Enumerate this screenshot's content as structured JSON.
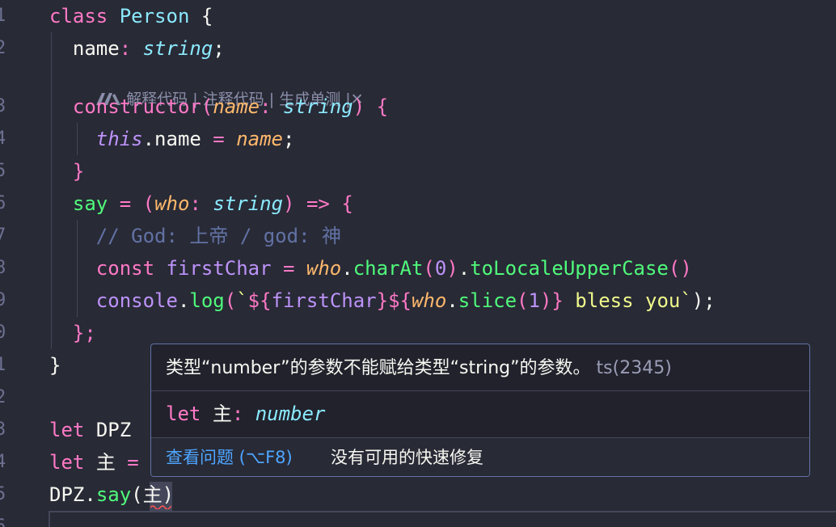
{
  "colors": {
    "background": "#282a36",
    "keyword": "#ff79c6",
    "class": "#8be9fd",
    "param": "#ffb86c",
    "function": "#50fa7b",
    "string": "#f1fa8c",
    "comment": "#6272a4",
    "link": "#4fa6ff",
    "error": "#ff5555"
  },
  "gutter": {
    "line_numbers": [
      "1",
      "2",
      "3",
      "4",
      "5",
      "6",
      "7",
      "8",
      "9",
      "0",
      "1",
      "2",
      "3",
      "4",
      "5",
      "6"
    ]
  },
  "code_lens": {
    "icon": "marscode-logo-icon",
    "explain": "解释代码",
    "annotate": "注释代码",
    "unit_test": "生成单测",
    "sep": "|",
    "close": "✕"
  },
  "code": {
    "l1": {
      "kw": "class",
      "name": "Person",
      "brace": "{"
    },
    "l2": {
      "prop": "name",
      "colon": ":",
      "type": "string",
      "semi": ";"
    },
    "l3": {
      "fn": "constructor",
      "lp": "(",
      "param": "name",
      "colon": ":",
      "type": "string",
      "rp": ")",
      "brace": "{"
    },
    "l4": {
      "this": "this",
      "prop": ".name",
      "eq": "=",
      "param": "name",
      "semi": ";"
    },
    "l5": {
      "brace": "}"
    },
    "l6": {
      "fn": "say",
      "eq": "=",
      "lp": "(",
      "param": "who",
      "colon": ":",
      "type": "string",
      "rp": ")",
      "arrow": "=>",
      "brace": "{"
    },
    "l7": {
      "comment": "// God: 上帝 / god: 神"
    },
    "l8": {
      "kw": "const",
      "var": "firstChar",
      "eq": "=",
      "param": "who",
      "dot1": ".",
      "m1": "charAt",
      "lp": "(",
      "num": "0",
      "rp": ")",
      "dot2": ".",
      "m2": "toLocaleUpperCase",
      "call": "()"
    },
    "l9": {
      "obj": "console",
      "dot": ".",
      "m": "log",
      "lp": "(",
      "tick": "`",
      "i1o": "${",
      "v1": "firstChar",
      "i1c": "}",
      "i2o": "${",
      "v2": "who",
      "dot2": ".",
      "m2": "slice",
      "lp2": "(",
      "num": "1",
      "rp2": ")",
      "i2c": "}",
      "text": " bless you",
      "tick2": "`",
      "rp": ");"
    },
    "l10": {
      "close": "};"
    },
    "l11": {
      "brace": "}"
    },
    "l13": {
      "kw": "let",
      "var": "DPZ"
    },
    "l14": {
      "kw": "let",
      "var": "主",
      "eq": "="
    },
    "l15": {
      "obj": "DPZ",
      "dot": ".",
      "m": "say",
      "lp": "(",
      "arg": "主",
      "rp": ")"
    }
  },
  "hover": {
    "message": "类型“number”的参数不能赋给类型“string”的参数。",
    "code_tag": "ts(2345)",
    "sig_kw": "let",
    "sig_name": "主",
    "sig_colon": ":",
    "sig_type": "number",
    "view_problem": "查看问题 (⌥F8)",
    "no_fix": "没有可用的快速修复"
  }
}
